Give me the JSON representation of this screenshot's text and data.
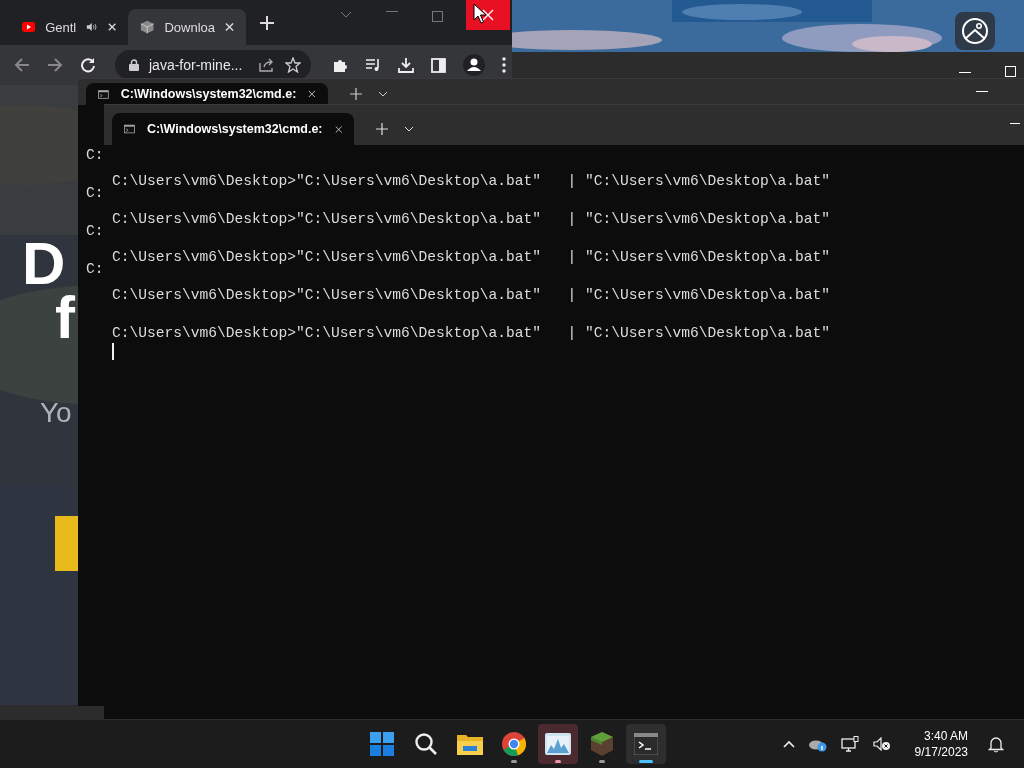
{
  "browser": {
    "tabs": [
      {
        "kind": "video",
        "title": "Gentl",
        "selected": false,
        "audio": true
      },
      {
        "kind": "package",
        "title": "Downloa",
        "selected": true,
        "audio": false
      }
    ],
    "address": "java-for-mine...",
    "page": {
      "heading_lines": [
        "D",
        "f"
      ],
      "subtitle": "Yo"
    }
  },
  "terminal_back": {
    "tab_title": "C:\\Windows\\system32\\cmd.e:",
    "lines": [
      "C:",
      "C:",
      "C:",
      "C:"
    ]
  },
  "terminal_front": {
    "tab_title": "C:\\Windows\\system32\\cmd.e:",
    "lines": [
      "C:\\Users\\vm6\\Desktop>\"C:\\Users\\vm6\\Desktop\\a.bat\"   | \"C:\\Users\\vm6\\Desktop\\a.bat\"",
      "C:\\Users\\vm6\\Desktop>\"C:\\Users\\vm6\\Desktop\\a.bat\"   | \"C:\\Users\\vm6\\Desktop\\a.bat\"",
      "C:\\Users\\vm6\\Desktop>\"C:\\Users\\vm6\\Desktop\\a.bat\"   | \"C:\\Users\\vm6\\Desktop\\a.bat\"",
      "C:\\Users\\vm6\\Desktop>\"C:\\Users\\vm6\\Desktop\\a.bat\"   | \"C:\\Users\\vm6\\Desktop\\a.bat\"",
      "C:\\Users\\vm6\\Desktop>\"C:\\Users\\vm6\\Desktop\\a.bat\"   | \"C:\\Users\\vm6\\Desktop\\a.bat\""
    ]
  },
  "taskbar": {
    "apps": [
      {
        "kind": "start",
        "running": false,
        "selected": false,
        "attention": false
      },
      {
        "kind": "search",
        "running": false,
        "selected": false,
        "attention": false
      },
      {
        "kind": "files",
        "running": false,
        "selected": false,
        "attention": false
      },
      {
        "kind": "chrome",
        "running": true,
        "selected": false,
        "attention": false
      },
      {
        "kind": "monitor",
        "running": true,
        "selected": false,
        "attention": true
      },
      {
        "kind": "block",
        "running": true,
        "selected": false,
        "attention": false
      },
      {
        "kind": "terminal",
        "running": true,
        "selected": true,
        "attention": false
      }
    ],
    "time": "3:40 AM",
    "date": "9/17/2023"
  }
}
